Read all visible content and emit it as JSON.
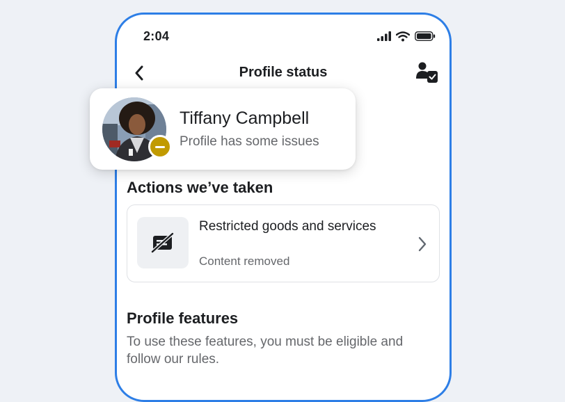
{
  "status_bar": {
    "time": "2:04"
  },
  "nav": {
    "title": "Profile status"
  },
  "profile": {
    "name": "Tiffany Campbell",
    "status": "Profile has some issues",
    "status_color": "#c19a00"
  },
  "actions": {
    "heading": "Actions we’ve taken",
    "items": [
      {
        "title": "Restricted goods and services",
        "subtitle": "Content removed",
        "icon": "restricted-goods-icon"
      }
    ]
  },
  "features": {
    "heading": "Profile features",
    "description": "To use these features, you must be eligible and follow our rules."
  },
  "colors": {
    "accent": "#2d7ee6",
    "background": "#eef1f6",
    "secondary_text": "#65676b"
  }
}
